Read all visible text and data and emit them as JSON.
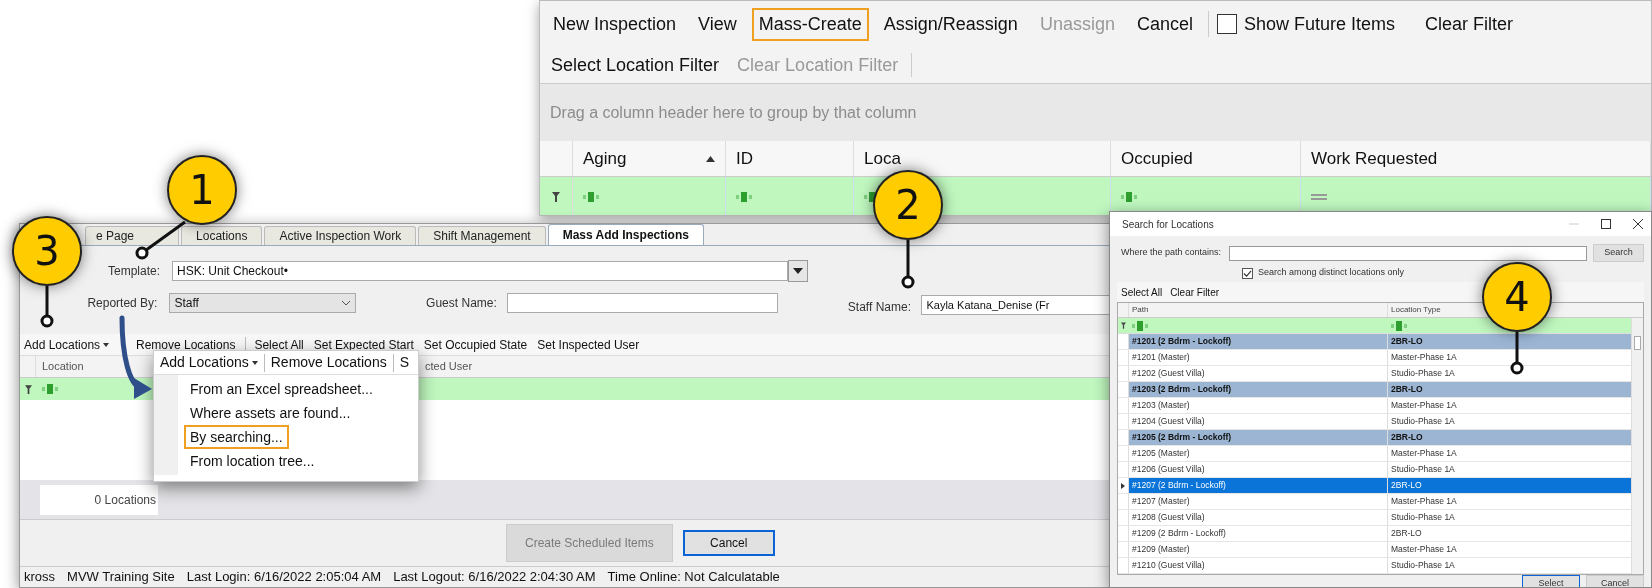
{
  "top_panel": {
    "toolbar": [
      {
        "label": "New Inspection",
        "disabled": false,
        "highlighted": false
      },
      {
        "label": "View",
        "disabled": false,
        "highlighted": false
      },
      {
        "label": "Mass-Create",
        "disabled": false,
        "highlighted": true
      },
      {
        "label": "Assign/Reassign",
        "disabled": false,
        "highlighted": false
      },
      {
        "label": "Unassign",
        "disabled": true,
        "highlighted": false
      },
      {
        "label": "Cancel",
        "disabled": false,
        "highlighted": false
      }
    ],
    "show_future_items": {
      "label": "Show Future Items",
      "checked": false
    },
    "clear_filter": "Clear Filter",
    "toolbar_row2": [
      {
        "label": "Select Location Filter",
        "disabled": false
      },
      {
        "label": "Clear Location Filter",
        "disabled": true
      }
    ],
    "group_hint": "Drag a column header here to group by that column",
    "columns": [
      {
        "label": "Aging",
        "sorted": true,
        "kind": "text"
      },
      {
        "label": "ID",
        "sorted": false,
        "kind": "text"
      },
      {
        "label": "Loca",
        "sorted": false,
        "kind": "text"
      },
      {
        "label": "Occupied",
        "sorted": false,
        "kind": "text"
      },
      {
        "label": "Work Requested",
        "sorted": false,
        "kind": "list"
      }
    ]
  },
  "main_window": {
    "tabs": [
      {
        "label": "e Page",
        "selected": false
      },
      {
        "label": "Locations",
        "selected": false
      },
      {
        "label": "Active Inspection Work",
        "selected": false
      },
      {
        "label": "Shift Management",
        "selected": false
      },
      {
        "label": "Mass Add Inspections",
        "selected": true
      }
    ],
    "template": {
      "label": "Template:",
      "value": "HSK: Unit Checkout•"
    },
    "reported_by": {
      "label": "Reported By:",
      "value": "Staff"
    },
    "guest_name": {
      "label": "Guest Name:"
    },
    "staff_name": {
      "label": "Staff Name:",
      "value": "Kayla Katana_Denise (Fr"
    },
    "toolbar": [
      {
        "label": "Add Locations",
        "dropdown": true
      },
      {
        "label": "Remove Locations",
        "dropdown": false
      },
      {
        "label": "Select All",
        "dropdown": false
      },
      {
        "label": "Set Expected Start",
        "dropdown": false
      },
      {
        "label": "Set Occupied State",
        "dropdown": false
      },
      {
        "label": "Set Inspected User",
        "dropdown": false
      }
    ],
    "columns": [
      {
        "label": "Location"
      },
      {
        "label": "cted User"
      }
    ],
    "location_count": "0 Locations",
    "buttons": [
      {
        "label": "Create Scheduled Items",
        "disabled": true,
        "focused": false
      },
      {
        "label": "Cancel",
        "disabled": false,
        "focused": true
      }
    ],
    "status_bar": [
      "kross",
      "MVW Training Site",
      "Last Login: 6/16/2022 2:05:04 AM",
      "Last Logout: 6/16/2022 2:04:30 AM",
      "Time Online: Not Calculatable"
    ]
  },
  "dropdown_menu": {
    "header": [
      {
        "label": "Add Locations",
        "dropdown": true
      },
      {
        "label": "Remove Locations",
        "dropdown": false
      },
      {
        "label": "S",
        "dropdown": false
      }
    ],
    "items": [
      {
        "label": "From an Excel spreadsheet...",
        "highlighted": false
      },
      {
        "label": "Where assets are found...",
        "highlighted": false
      },
      {
        "label": "By searching...",
        "highlighted": true
      },
      {
        "label": "From location tree...",
        "highlighted": false
      }
    ]
  },
  "dialog": {
    "title": "Search for Locations",
    "path_label": "Where the path contains:",
    "search_button": "Search",
    "distinct_only": {
      "label": "Search among distinct locations only",
      "checked": true
    },
    "toolbar": [
      "Select All",
      "Clear Filter"
    ],
    "columns": [
      "Path",
      "Location Type"
    ],
    "rows": [
      {
        "path": "#1201 (2 Bdrm - Lockoff)",
        "type": "2BR-LO",
        "selected": true,
        "focused": false
      },
      {
        "path": "#1201 (Master)",
        "type": "Master-Phase 1A",
        "selected": false,
        "focused": false
      },
      {
        "path": "#1202 (Guest Villa)",
        "type": "Studio-Phase 1A",
        "selected": false,
        "focused": false
      },
      {
        "path": "#1203 (2 Bdrm - Lockoff)",
        "type": "2BR-LO",
        "selected": true,
        "focused": false
      },
      {
        "path": "#1203 (Master)",
        "type": "Master-Phase 1A",
        "selected": false,
        "focused": false
      },
      {
        "path": "#1204 (Guest Villa)",
        "type": "Studio-Phase 1A",
        "selected": false,
        "focused": false
      },
      {
        "path": "#1205 (2 Bdrm - Lockoff)",
        "type": "2BR-LO",
        "selected": true,
        "focused": false
      },
      {
        "path": "#1205 (Master)",
        "type": "Master-Phase 1A",
        "selected": false,
        "focused": false
      },
      {
        "path": "#1206 (Guest Villa)",
        "type": "Studio-Phase 1A",
        "selected": false,
        "focused": false
      },
      {
        "path": "#1207 (2 Bdrm - Lockoff)",
        "type": "2BR-LO",
        "selected": true,
        "focused": true
      },
      {
        "path": "#1207 (Master)",
        "type": "Master-Phase 1A",
        "selected": false,
        "focused": false
      },
      {
        "path": "#1208 (Guest Villa)",
        "type": "Studio-Phase 1A",
        "selected": false,
        "focused": false
      },
      {
        "path": "#1209 (2 Bdrm - Lockoff)",
        "type": "2BR-LO",
        "selected": false,
        "focused": false
      },
      {
        "path": "#1209 (Master)",
        "type": "Master-Phase 1A",
        "selected": false,
        "focused": false
      },
      {
        "path": "#1210 (Guest Villa)",
        "type": "Studio-Phase 1A",
        "selected": false,
        "focused": false
      }
    ],
    "buttons": [
      "Select",
      "Cancel"
    ]
  },
  "callouts": [
    {
      "label": "1"
    },
    {
      "label": "2"
    },
    {
      "label": "3"
    },
    {
      "label": "4"
    }
  ]
}
